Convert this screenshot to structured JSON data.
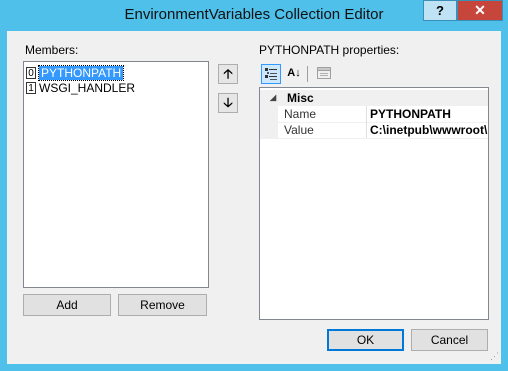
{
  "window": {
    "title": "EnvironmentVariables Collection Editor",
    "help_label": "?",
    "close_label": "✕"
  },
  "members": {
    "label": "Members:",
    "items": [
      {
        "index": "0",
        "name": "PYTHONPATH",
        "selected": true
      },
      {
        "index": "1",
        "name": "WSGI_HANDLER",
        "selected": false
      }
    ],
    "up_label": "🡡",
    "down_label": "🡣",
    "add_label": "Add",
    "remove_label": "Remove"
  },
  "properties": {
    "label": "PYTHONPATH properties:",
    "toolbar": {
      "categorized_icon": "categorized-icon",
      "alphabetical_icon": "alphabetical-icon",
      "alphabetical_glyph": "A↓",
      "property_pages_icon": "property-pages-icon"
    },
    "category": {
      "name": "Misc",
      "expanded_glyph": "◢"
    },
    "rows": [
      {
        "name": "Name",
        "value": "PYTHONPATH"
      },
      {
        "name": "Value",
        "value": "C:\\inetpub\\wwwroot\\"
      }
    ]
  },
  "dialog": {
    "ok_label": "OK",
    "cancel_label": "Cancel"
  },
  "colors": {
    "titlebar": "#4ec0ea",
    "close_button": "#c7463b",
    "selection": "#3399ff"
  }
}
